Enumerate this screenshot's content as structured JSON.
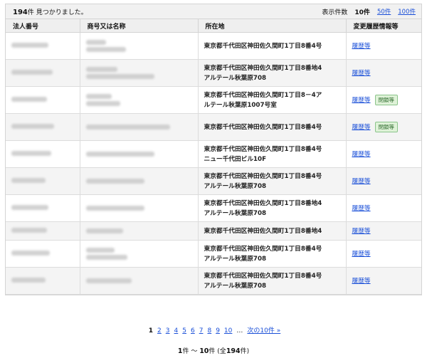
{
  "result": {
    "count": "194",
    "suffix": "件 見つかりました。"
  },
  "perpage": {
    "label": "表示件数",
    "current": "10件",
    "opt50": "50件",
    "opt100": "100件"
  },
  "columns": [
    "法人番号",
    "商号又は名称",
    "所在地",
    "変更履歴情報等"
  ],
  "rows": [
    {
      "address": "東京都千代田区神田佐久間町1丁目8番4号",
      "history": "履歴等",
      "badge": ""
    },
    {
      "address": "東京都千代田区神田佐久間町1丁目8番地4\nアルテール秋葉原708",
      "history": "履歴等",
      "badge": ""
    },
    {
      "address": "東京都千代田区神田佐久間町1丁目8－4ア\nルテール秋葉原1007号室",
      "history": "履歴等",
      "badge": "閉鎖等"
    },
    {
      "address": "東京都千代田区神田佐久間町1丁目8番4号",
      "history": "履歴等",
      "badge": "閉鎖等"
    },
    {
      "address": "東京都千代田区神田佐久間町1丁目8番4号\nニュー千代田ビル10F",
      "history": "履歴等",
      "badge": ""
    },
    {
      "address": "東京都千代田区神田佐久間町1丁目8番4号\nアルテール秋葉原708",
      "history": "履歴等",
      "badge": ""
    },
    {
      "address": "東京都千代田区神田佐久間町1丁目8番地4\nアルテール秋葉原708",
      "history": "履歴等",
      "badge": ""
    },
    {
      "address": "東京都千代田区神田佐久間町1丁目8番地4",
      "history": "履歴等",
      "badge": ""
    },
    {
      "address": "東京都千代田区神田佐久間町1丁目8番4号\nアルテール秋葉原708",
      "history": "履歴等",
      "badge": ""
    },
    {
      "address": "東京都千代田区神田佐久間町1丁目8番4号\nアルテール秋葉原708",
      "history": "履歴等",
      "badge": ""
    }
  ],
  "pagination": {
    "pages": [
      "1",
      "2",
      "3",
      "4",
      "5",
      "6",
      "7",
      "8",
      "9",
      "10"
    ],
    "current": "1",
    "ellipsis": "…",
    "next": "次の10件 »"
  },
  "summary": {
    "start": "1",
    "start_unit": "件",
    "sep": " ～ ",
    "end": "10",
    "end_unit": "件",
    "total_open": " (全",
    "total": "194",
    "total_close": "件)"
  }
}
